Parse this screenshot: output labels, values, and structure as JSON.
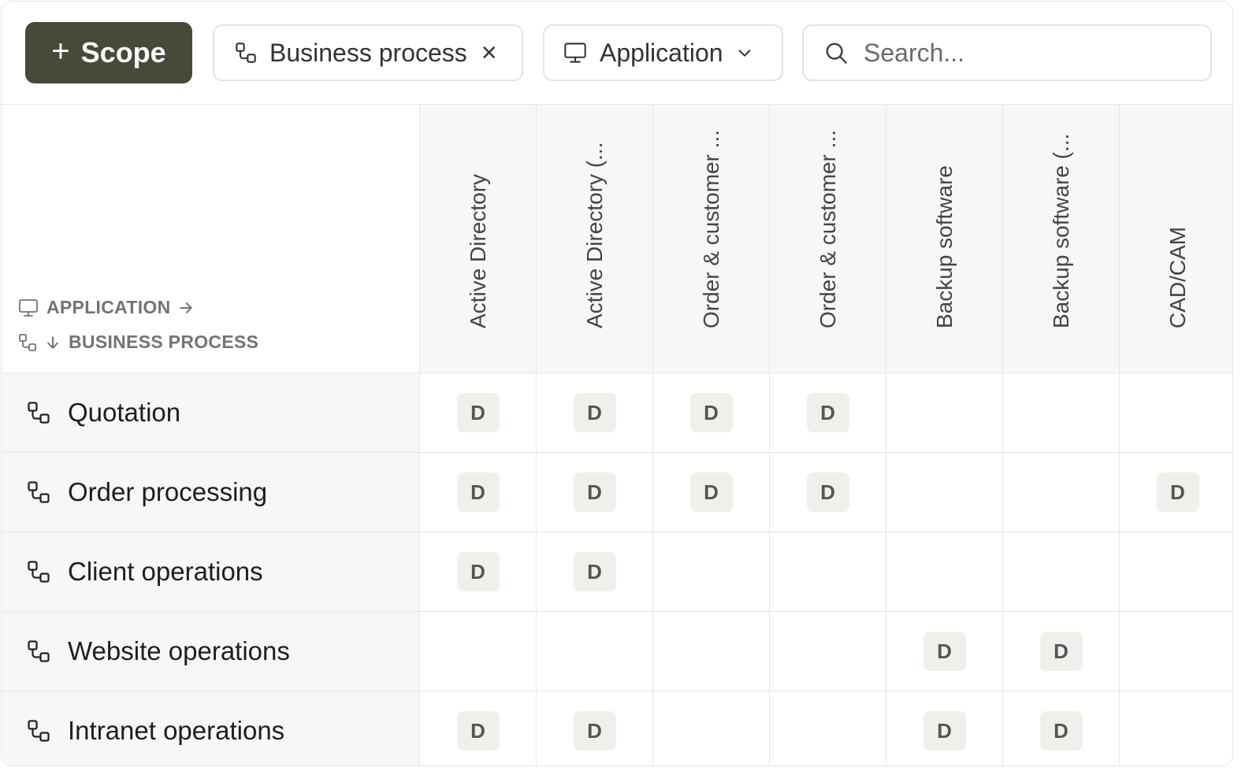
{
  "toolbar": {
    "scope_button": {
      "icon": "plus-icon",
      "label": "Scope"
    },
    "business_process_filter": {
      "icon": "process-icon",
      "label": "Business process",
      "close_icon": "close-icon"
    },
    "application_filter": {
      "icon": "monitor-icon",
      "label": "Application",
      "chevron": "chevron-down-icon"
    },
    "search": {
      "icon": "search-icon",
      "placeholder": "Search...",
      "value": ""
    }
  },
  "matrix": {
    "axis_application": "APPLICATION",
    "axis_business_process": "BUSINESS PROCESS",
    "columns": [
      "Active Directory",
      "Active Directory (...",
      "Order & customer ...",
      "Order & customer ...",
      "Backup software",
      "Backup software (...",
      "CAD/CAM"
    ],
    "rows": [
      {
        "label": "Quotation",
        "cells": [
          "D",
          "D",
          "D",
          "D",
          "",
          "",
          ""
        ]
      },
      {
        "label": "Order processing",
        "cells": [
          "D",
          "D",
          "D",
          "D",
          "",
          "",
          "D"
        ]
      },
      {
        "label": "Client operations",
        "cells": [
          "D",
          "D",
          "",
          "",
          "",
          "",
          ""
        ]
      },
      {
        "label": "Website operations",
        "cells": [
          "",
          "",
          "",
          "",
          "D",
          "D",
          ""
        ]
      },
      {
        "label": "Intranet operations",
        "cells": [
          "D",
          "D",
          "",
          "",
          "D",
          "D",
          ""
        ]
      }
    ]
  },
  "colors": {
    "primary_button": "#454a39",
    "header_bg": "#f7f7f5",
    "badge_bg": "#efefeb"
  }
}
